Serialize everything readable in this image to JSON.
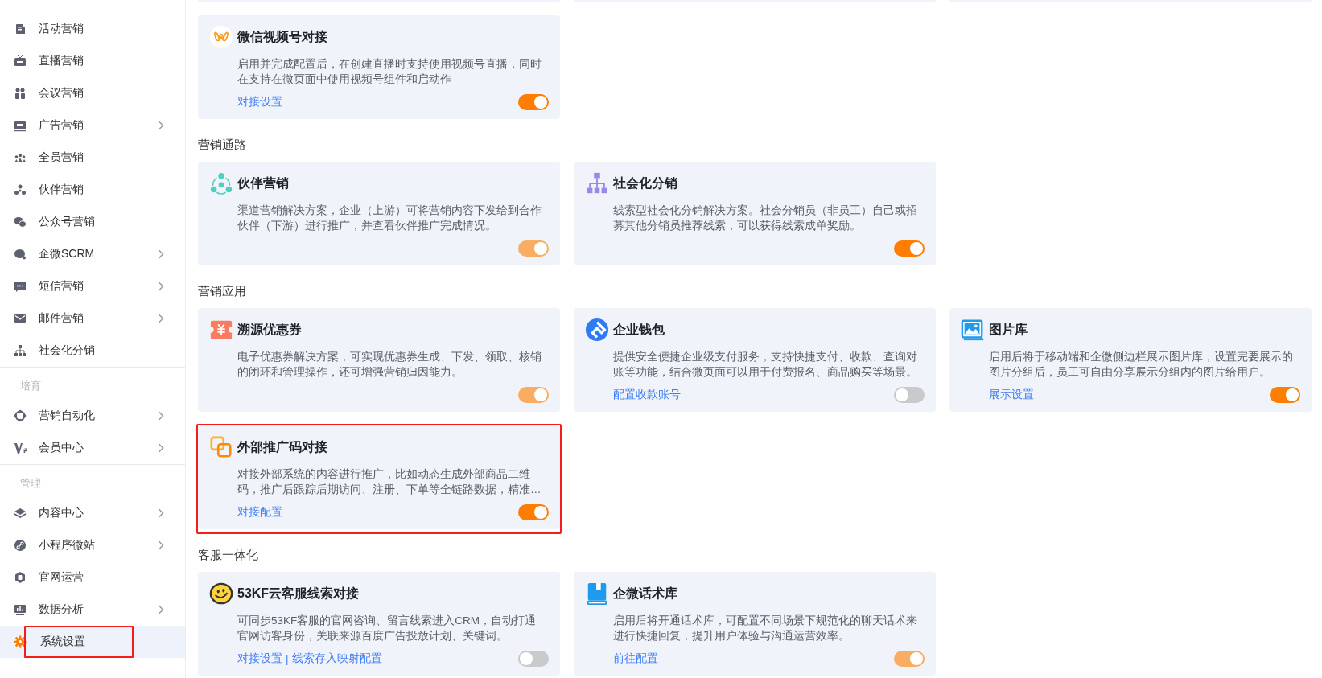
{
  "sidebar": {
    "groups": [
      {
        "items": [
          {
            "label": "活动营销",
            "has_submenu": false,
            "selected": false,
            "highlighted": false
          },
          {
            "label": "直播营销",
            "has_submenu": false,
            "selected": false,
            "highlighted": false
          },
          {
            "label": "会议营销",
            "has_submenu": false,
            "selected": false,
            "highlighted": false
          },
          {
            "label": "广告营销",
            "has_submenu": true,
            "selected": false,
            "highlighted": false
          },
          {
            "label": "全员营销",
            "has_submenu": false,
            "selected": false,
            "highlighted": false
          },
          {
            "label": "伙伴营销",
            "has_submenu": false,
            "selected": false,
            "highlighted": false
          },
          {
            "label": "公众号营销",
            "has_submenu": false,
            "selected": false,
            "highlighted": false
          },
          {
            "label": "企微SCRM",
            "has_submenu": true,
            "selected": false,
            "highlighted": false
          },
          {
            "label": "短信营销",
            "has_submenu": true,
            "selected": false,
            "highlighted": false
          },
          {
            "label": "邮件营销",
            "has_submenu": true,
            "selected": false,
            "highlighted": false
          },
          {
            "label": "社会化分销",
            "has_submenu": false,
            "selected": false,
            "highlighted": false
          }
        ]
      },
      {
        "heading": "培育",
        "items": [
          {
            "label": "营销自动化",
            "has_submenu": true,
            "selected": false,
            "highlighted": false
          },
          {
            "label": "会员中心",
            "has_submenu": true,
            "selected": false,
            "highlighted": false
          }
        ]
      },
      {
        "heading": "管理",
        "items": [
          {
            "label": "内容中心",
            "has_submenu": true,
            "selected": false,
            "highlighted": false
          },
          {
            "label": "小程序微站",
            "has_submenu": true,
            "selected": false,
            "highlighted": false
          },
          {
            "label": "官网运营",
            "has_submenu": false,
            "selected": false,
            "highlighted": false
          },
          {
            "label": "数据分析",
            "has_submenu": true,
            "selected": false,
            "highlighted": false
          },
          {
            "label": "系统设置",
            "has_submenu": false,
            "selected": true,
            "highlighted": true
          }
        ]
      }
    ]
  },
  "sections": [
    {
      "rows": [
        [
          {
            "title": "微信视频号对接",
            "description": "启用并完成配置后，在创建直播时支持使用视频号直播，同时在支持在微页面中使用视频号组件和启动作",
            "links": [
              "对接设置"
            ],
            "toggle": {
              "on": true,
              "disabled": false
            },
            "highlighted": false
          }
        ]
      ]
    },
    {
      "heading": "营销通路",
      "rows": [
        [
          {
            "title": "伙伴营销",
            "description": "渠道营销解决方案，企业（上游）可将营销内容下发给到合作伙伴（下游）进行推广，并查看伙伴推广完成情况。",
            "toggle": {
              "on": true,
              "disabled": true
            },
            "highlighted": false
          },
          {
            "title": "社会化分销",
            "description": "线索型社会化分销解决方案。社会分销员（非员工）自己或招募其他分销员推荐线索，可以获得线索成单奖励。",
            "toggle": {
              "on": true,
              "disabled": false
            },
            "highlighted": false
          }
        ]
      ]
    },
    {
      "heading": "营销应用",
      "rows": [
        [
          {
            "title": "溯源优惠券",
            "description": "电子优惠券解决方案，可实现优惠券生成、下发、领取、核销的闭环和管理操作，还可增强营销归因能力。",
            "toggle": {
              "on": true,
              "disabled": true
            },
            "highlighted": false
          },
          {
            "title": "企业钱包",
            "description": "提供安全便捷企业级支付服务，支持快捷支付、收款、查询对账等功能，结合微页面可以用于付费报名、商品购买等场景。",
            "links": [
              "配置收款账号"
            ],
            "toggle": {
              "on": false,
              "disabled": false
            },
            "highlighted": false
          },
          {
            "title": "图片库",
            "description": "启用后将于移动端和企微侧边栏展示图片库，设置完要展示的图片分组后，员工可自由分享展示分组内的图片给用户。",
            "links": [
              "展示设置"
            ],
            "toggle": {
              "on": true,
              "disabled": false
            },
            "highlighted": false
          }
        ],
        [
          {
            "title": "外部推广码对接",
            "description": "对接外部系统的内容进行推广，比如动态生成外部商品二维码，推广后跟踪后期访问、注册、下单等全链路数据，精准…",
            "links": [
              "对接配置"
            ],
            "toggle": {
              "on": true,
              "disabled": false
            },
            "highlighted": true
          }
        ]
      ]
    },
    {
      "heading": "客服一体化",
      "rows": [
        [
          {
            "title": "53KF云客服线索对接",
            "description": "可同步53KF客服的官网咨询、留言线索进入CRM，自动打通官网访客身份，关联来源百度广告投放计划、关键词。",
            "links": [
              "对接设置",
              "线索存入映射配置"
            ],
            "separator": "|",
            "toggle": {
              "on": false,
              "disabled": false
            },
            "highlighted": false
          },
          {
            "title": "企微话术库",
            "description": "启用后将开通话术库，可配置不同场景下规范化的聊天话术来进行快捷回复，提升用户体验与沟通运营效率。",
            "links": [
              "前往配置"
            ],
            "toggle": {
              "on": true,
              "disabled": true
            },
            "highlighted": false
          }
        ]
      ]
    }
  ]
}
